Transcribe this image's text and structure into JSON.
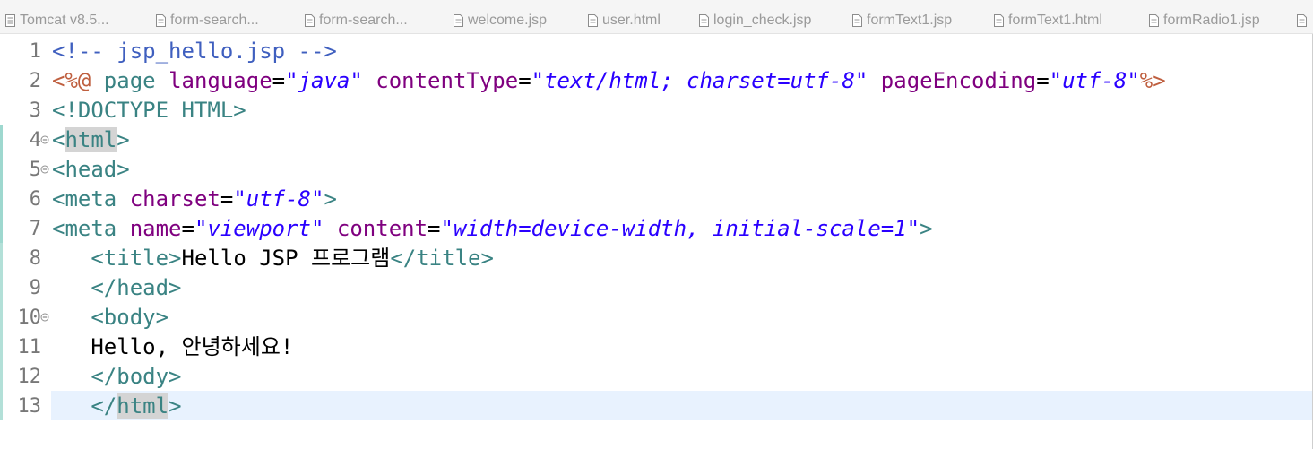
{
  "tabs": [
    {
      "label": "Tomcat v8.5...",
      "icon": "server-file-icon"
    },
    {
      "label": "form-search...",
      "icon": "jsp-file-icon"
    },
    {
      "label": "form-search...",
      "icon": "jsp-file-icon"
    },
    {
      "label": "welcome.jsp",
      "icon": "jsp-file-icon"
    },
    {
      "label": "user.html",
      "icon": "html-file-icon"
    },
    {
      "label": "login_check.jsp",
      "icon": "jsp-file-icon"
    },
    {
      "label": "formText1.jsp",
      "icon": "jsp-file-icon"
    },
    {
      "label": "formText1.html",
      "icon": "html-file-icon"
    },
    {
      "label": "formRadio1.jsp",
      "icon": "jsp-file-icon"
    }
  ],
  "editor": {
    "line_numbers": [
      "1",
      "2",
      "3",
      "4",
      "5",
      "6",
      "7",
      "8",
      "9",
      "10",
      "11",
      "12",
      "13"
    ],
    "fold_markers": [
      "4",
      "5",
      "10"
    ],
    "current_line": "13",
    "lines": {
      "l1": {
        "comment": "<!-- jsp_hello.jsp -->"
      },
      "l2": {
        "open": "<%@",
        "page": " page ",
        "language": "language",
        "eq1": "=",
        "language_val": "\"java\"",
        "contentType": " contentType",
        "eq2": "=",
        "contentType_val": "\"text/html; charset=utf-8\"",
        "pageEncoding": " pageEncoding",
        "eq3": "=",
        "pageEncoding_val": "\"utf-8\"",
        "close": "%>"
      },
      "l3": {
        "doctype": "<!DOCTYPE HTML>"
      },
      "l4": {
        "lt": "<",
        "name": "html",
        "gt": ">"
      },
      "l5": {
        "tag": "<head>"
      },
      "l6": {
        "open": "<meta ",
        "attr": "charset",
        "eq": "=",
        "val": "\"utf-8\"",
        "close": ">"
      },
      "l7": {
        "open": "<meta ",
        "name_attr": "name",
        "eq1": "=",
        "name_val": "\"viewport\"",
        "content_attr": " content",
        "eq2": "=",
        "content_val": "\"width=device-width, initial-scale=1\"",
        "close": ">"
      },
      "l8": {
        "indent": "   ",
        "open": "<title>",
        "text": "Hello JSP 프로그램",
        "close": "</title>"
      },
      "l9": {
        "indent": "   ",
        "tag": "</head>"
      },
      "l10": {
        "indent": "   ",
        "tag": "<body>"
      },
      "l11": {
        "indent": "   ",
        "text": "Hello, 안녕하세요!"
      },
      "l12": {
        "indent": "   ",
        "tag": "</body>"
      },
      "l13": {
        "indent": "   ",
        "lt": "</",
        "name": "html",
        "gt": ">"
      }
    }
  },
  "colors": {
    "tag": "#3a8383",
    "comment": "#3f5fbf",
    "attribute": "#7f007f",
    "value": "#2a00ff",
    "directive": "#bf5f3f",
    "current_line": "#e8f2fe",
    "change_bar": "#9ed8cf"
  }
}
